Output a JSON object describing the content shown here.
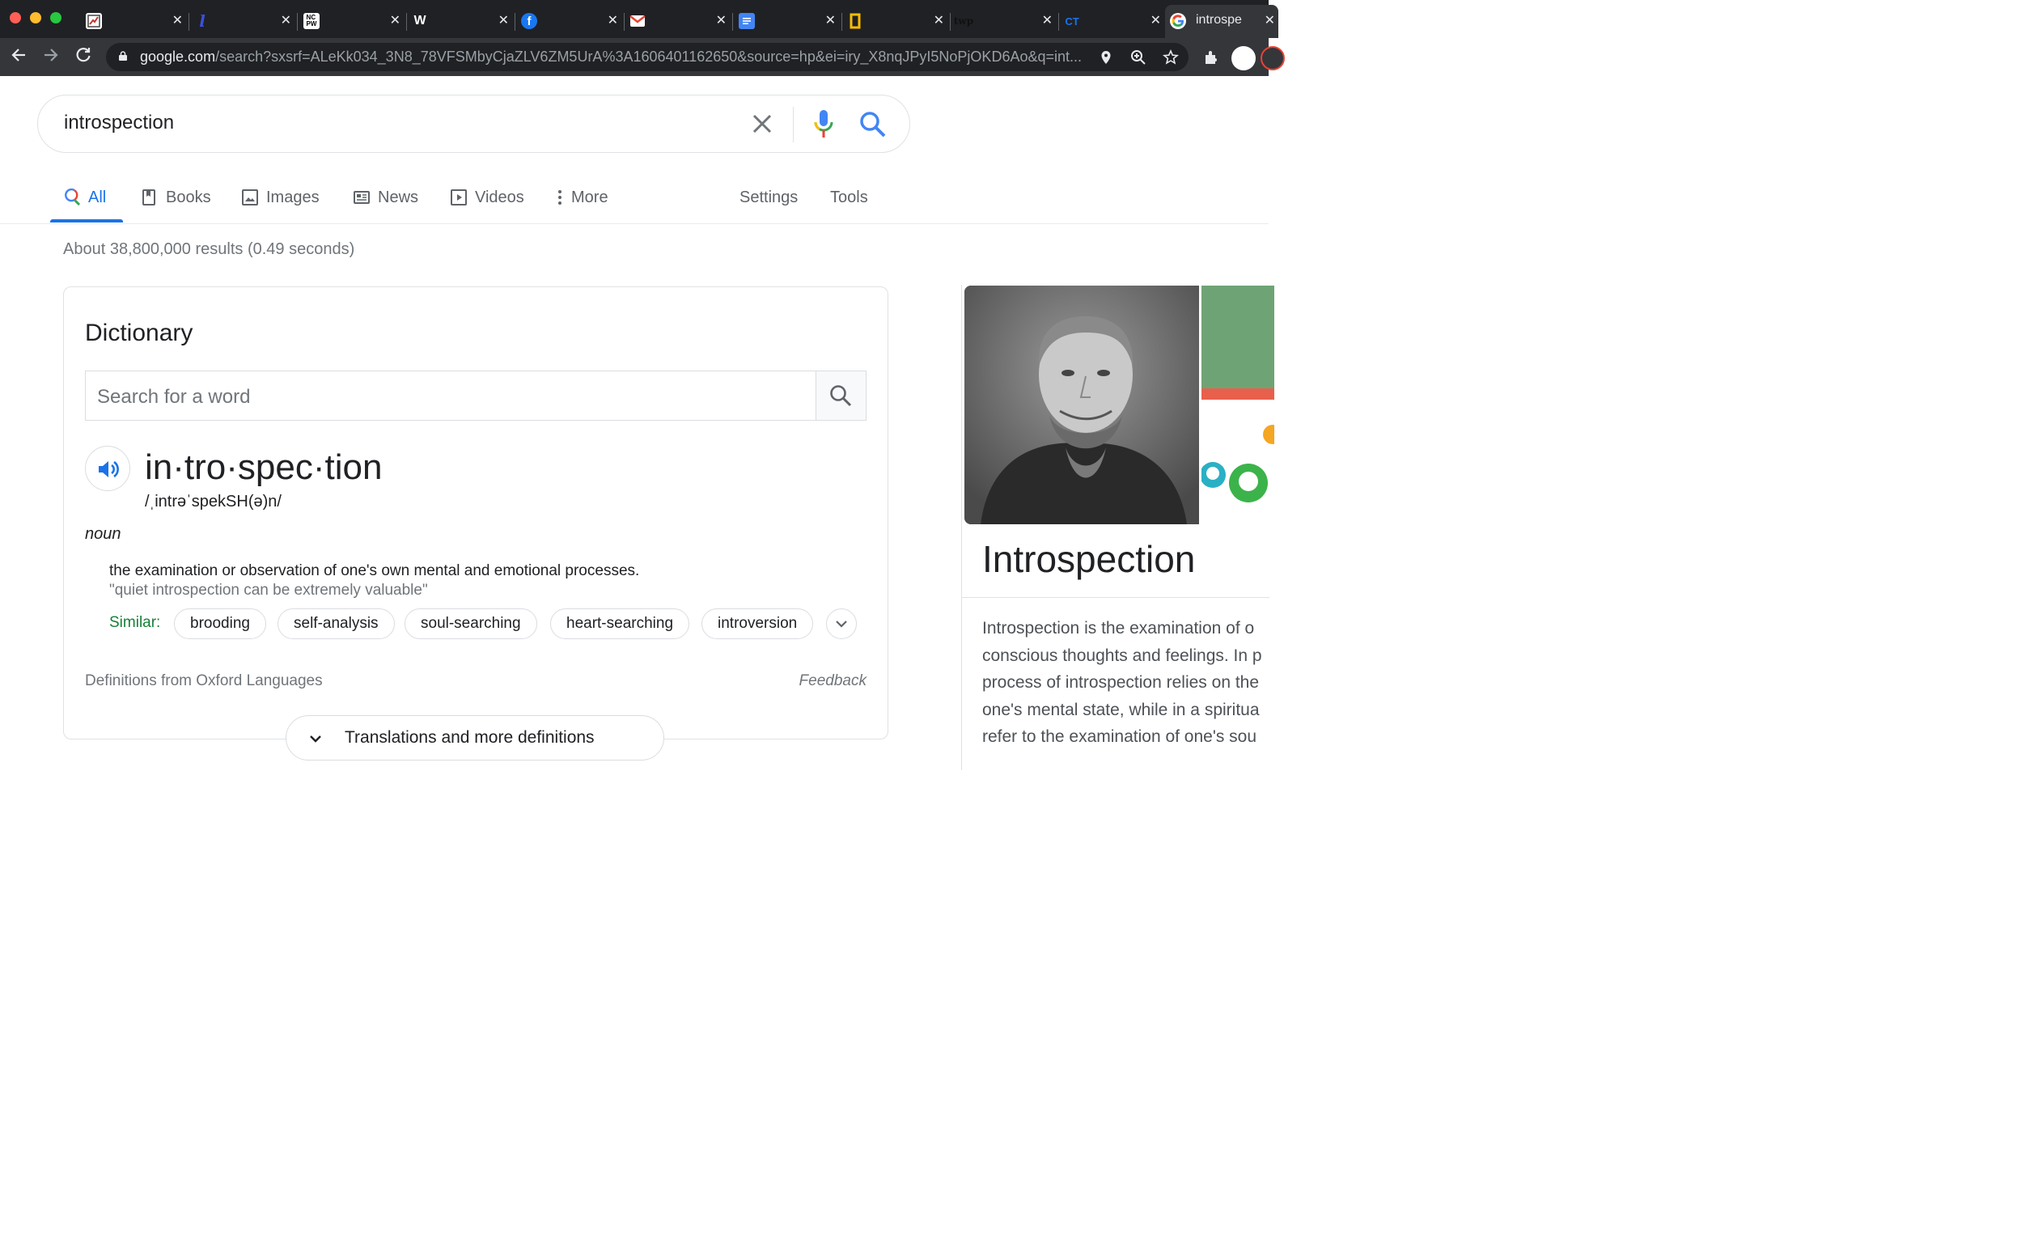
{
  "browser": {
    "tabs": [
      {
        "icon": "tab-favicon-chart-icon",
        "color": "#ffffff"
      },
      {
        "icon": "tab-favicon-l-icon",
        "color": "#3c4fe0"
      },
      {
        "icon": "tab-favicon-nc-pw-icon",
        "color": "#ffffff"
      },
      {
        "icon": "tab-favicon-w-icon",
        "color": "#ffffff"
      },
      {
        "icon": "tab-favicon-facebook-icon",
        "color": "#1877f2"
      },
      {
        "icon": "tab-favicon-gmail-icon",
        "color": "#ea4335"
      },
      {
        "icon": "tab-favicon-docs-icon",
        "color": "#4285f4"
      },
      {
        "icon": "tab-favicon-yellow-frame-icon",
        "color": "#fbbc04"
      },
      {
        "icon": "tab-favicon-twp-icon",
        "color": "#000000"
      },
      {
        "icon": "tab-favicon-ct-icon",
        "color": "#1a73e8"
      },
      {
        "icon": "tab-favicon-google-icon",
        "title": "introspe",
        "active": true
      }
    ],
    "url_host": "google.com",
    "url_path": "/search?sxsrf=ALeKk034_3N8_78VFSMbyCjaZLV6ZM5UrA%3A1606401162650&source=hp&ei=iry_X8nqJPyI5NoPjOKD6Ao&q=int..."
  },
  "search": {
    "query": "introspection"
  },
  "nav": {
    "all": "All",
    "books": "Books",
    "images": "Images",
    "news": "News",
    "videos": "Videos",
    "more": "More",
    "settings": "Settings",
    "tools": "Tools"
  },
  "result_stats": "About 38,800,000 results (0.49 seconds)",
  "dictionary": {
    "title": "Dictionary",
    "search_placeholder": "Search for a word",
    "headword": "in·tro·spec·tion",
    "phonetic": "/ˌintrəˈspekSH(ə)n/",
    "part_of_speech": "noun",
    "definition": "the examination or observation of one's own mental and emotional processes.",
    "example": "\"quiet introspection can be extremely valuable\"",
    "similar_label": "Similar:",
    "similar": [
      "brooding",
      "self-analysis",
      "soul-searching",
      "heart-searching",
      "introversion"
    ],
    "source": "Definitions from Oxford Languages",
    "feedback": "Feedback",
    "more_button": "Translations and more definitions"
  },
  "knowledge_panel": {
    "title": "Introspection",
    "description_lines": [
      "Introspection is the examination of o",
      "conscious thoughts and feelings. In p",
      "process of introspection relies on the",
      "one's mental state, while in a spiritua",
      "refer to the examination of one's sou"
    ]
  },
  "colors": {
    "accent": "#1a73e8",
    "similar_green": "#188038",
    "chrome_dark": "#202124",
    "chrome_toolbar": "#35363a"
  }
}
